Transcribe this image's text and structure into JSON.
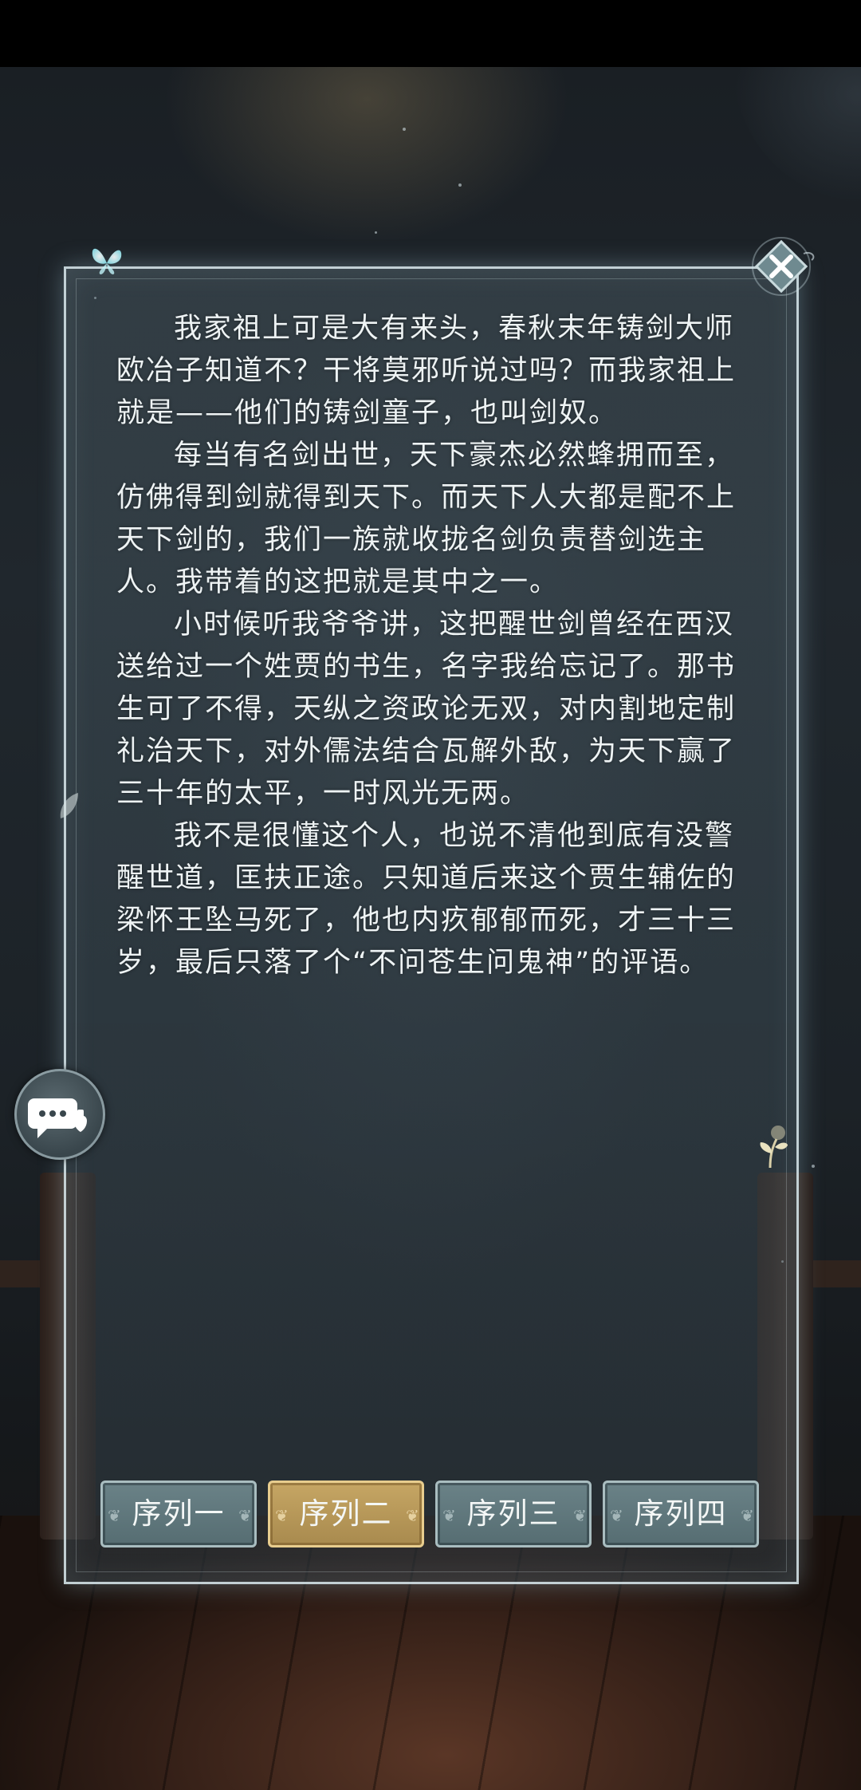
{
  "story": {
    "paragraphs": [
      "我家祖上可是大有来头，春秋末年铸剑大师欧冶子知道不？干将莫邪听说过吗？而我家祖上就是——他们的铸剑童子，也叫剑奴。",
      "每当有名剑出世，天下豪杰必然蜂拥而至，仿佛得到剑就得到天下。而天下人大都是配不上天下剑的，我们一族就收拢名剑负责替剑选主人。我带着的这把就是其中之一。",
      "小时候听我爷爷讲，这把醒世剑曾经在西汉送给过一个姓贾的书生，名字我给忘记了。那书生可了不得，天纵之资政论无双，对内割地定制礼治天下，对外儒法结合瓦解外敌，为天下赢了三十年的太平，一时风光无两。",
      "我不是很懂这个人，也说不清他到底有没警醒世道，匡扶正途。只知道后来这个贾生辅佐的梁怀王坠马死了，他也内疚郁郁而死，才三十三岁，最后只落了个“不问苍生问鬼神”的评语。"
    ]
  },
  "tabs": [
    {
      "label": "序列一",
      "active": false
    },
    {
      "label": "序列二",
      "active": true
    },
    {
      "label": "序列三",
      "active": false
    },
    {
      "label": "序列四",
      "active": false
    }
  ],
  "icons": {
    "close": "close-icon",
    "chat": "chat-bubble-icon",
    "butterfly": "butterfly-icon",
    "sprout": "sprout-icon"
  },
  "colors": {
    "panel_border": "#dcebf0",
    "tab_default": "#6a8287",
    "tab_active": "#c6a664",
    "text": "#eef3f4"
  }
}
